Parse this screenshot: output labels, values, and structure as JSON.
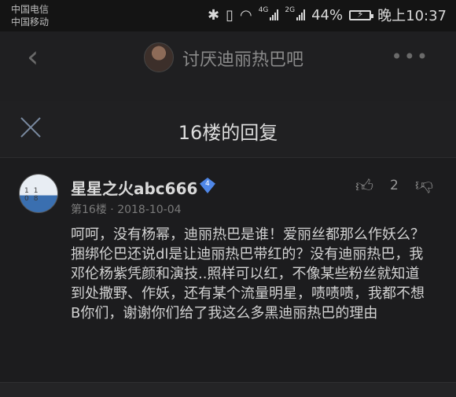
{
  "status_bar": {
    "carrier_1": "中国电信",
    "carrier_2": "中国移动",
    "sig1_label": "4G",
    "sig2_label": "2G",
    "battery": "44%",
    "time": "晚上10:37"
  },
  "header": {
    "forum_name": "讨厌迪丽热巴吧",
    "more_glyph": "•••"
  },
  "sheet": {
    "title": "16楼的回复"
  },
  "reply": {
    "username": "星星之火abc666",
    "level": "4",
    "floor": "第16楼",
    "separator": "·",
    "date": "2018-10-04",
    "likes": "2",
    "avatar_text": "11 08",
    "content": "呵呵，没有杨幂，迪丽热巴是谁！爱丽丝都那么作妖么？捆绑伦巴还说dl是让迪丽热巴带红的？没有迪丽热巴，我邓伦杨紫凭颜和演技..照样可以红，不像某些粉丝就知道到处撒野、作妖，还有某个流量明星，啧啧啧，我都不想B你们，谢谢你们给了我这么多黑迪丽热巴的理由"
  }
}
